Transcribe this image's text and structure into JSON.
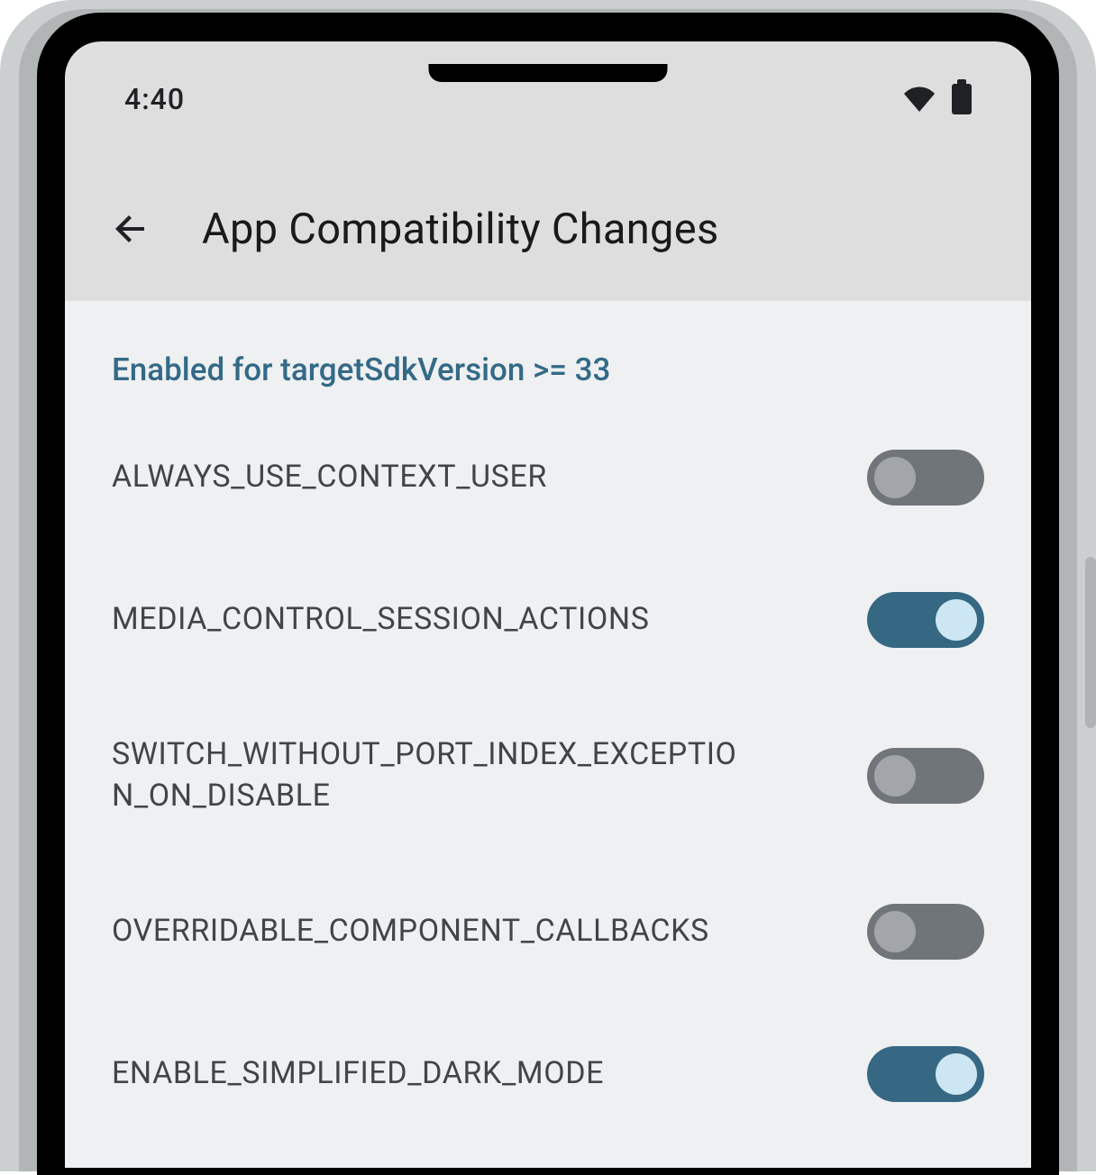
{
  "statusBar": {
    "time": "4:40"
  },
  "header": {
    "title": "App Compatibility Changes"
  },
  "section": {
    "title": "Enabled for targetSdkVersion >= 33"
  },
  "items": [
    {
      "label": "ALWAYS_USE_CONTEXT_USER",
      "enabled": false
    },
    {
      "label": "MEDIA_CONTROL_SESSION_ACTIONS",
      "enabled": true
    },
    {
      "label": "SWITCH_WITHOUT_PORT_INDEX_EXCEPTION_ON_DISABLE",
      "enabled": false
    },
    {
      "label": "OVERRIDABLE_COMPONENT_CALLBACKS",
      "enabled": false
    },
    {
      "label": "ENABLE_SIMPLIFIED_DARK_MODE",
      "enabled": true
    }
  ]
}
